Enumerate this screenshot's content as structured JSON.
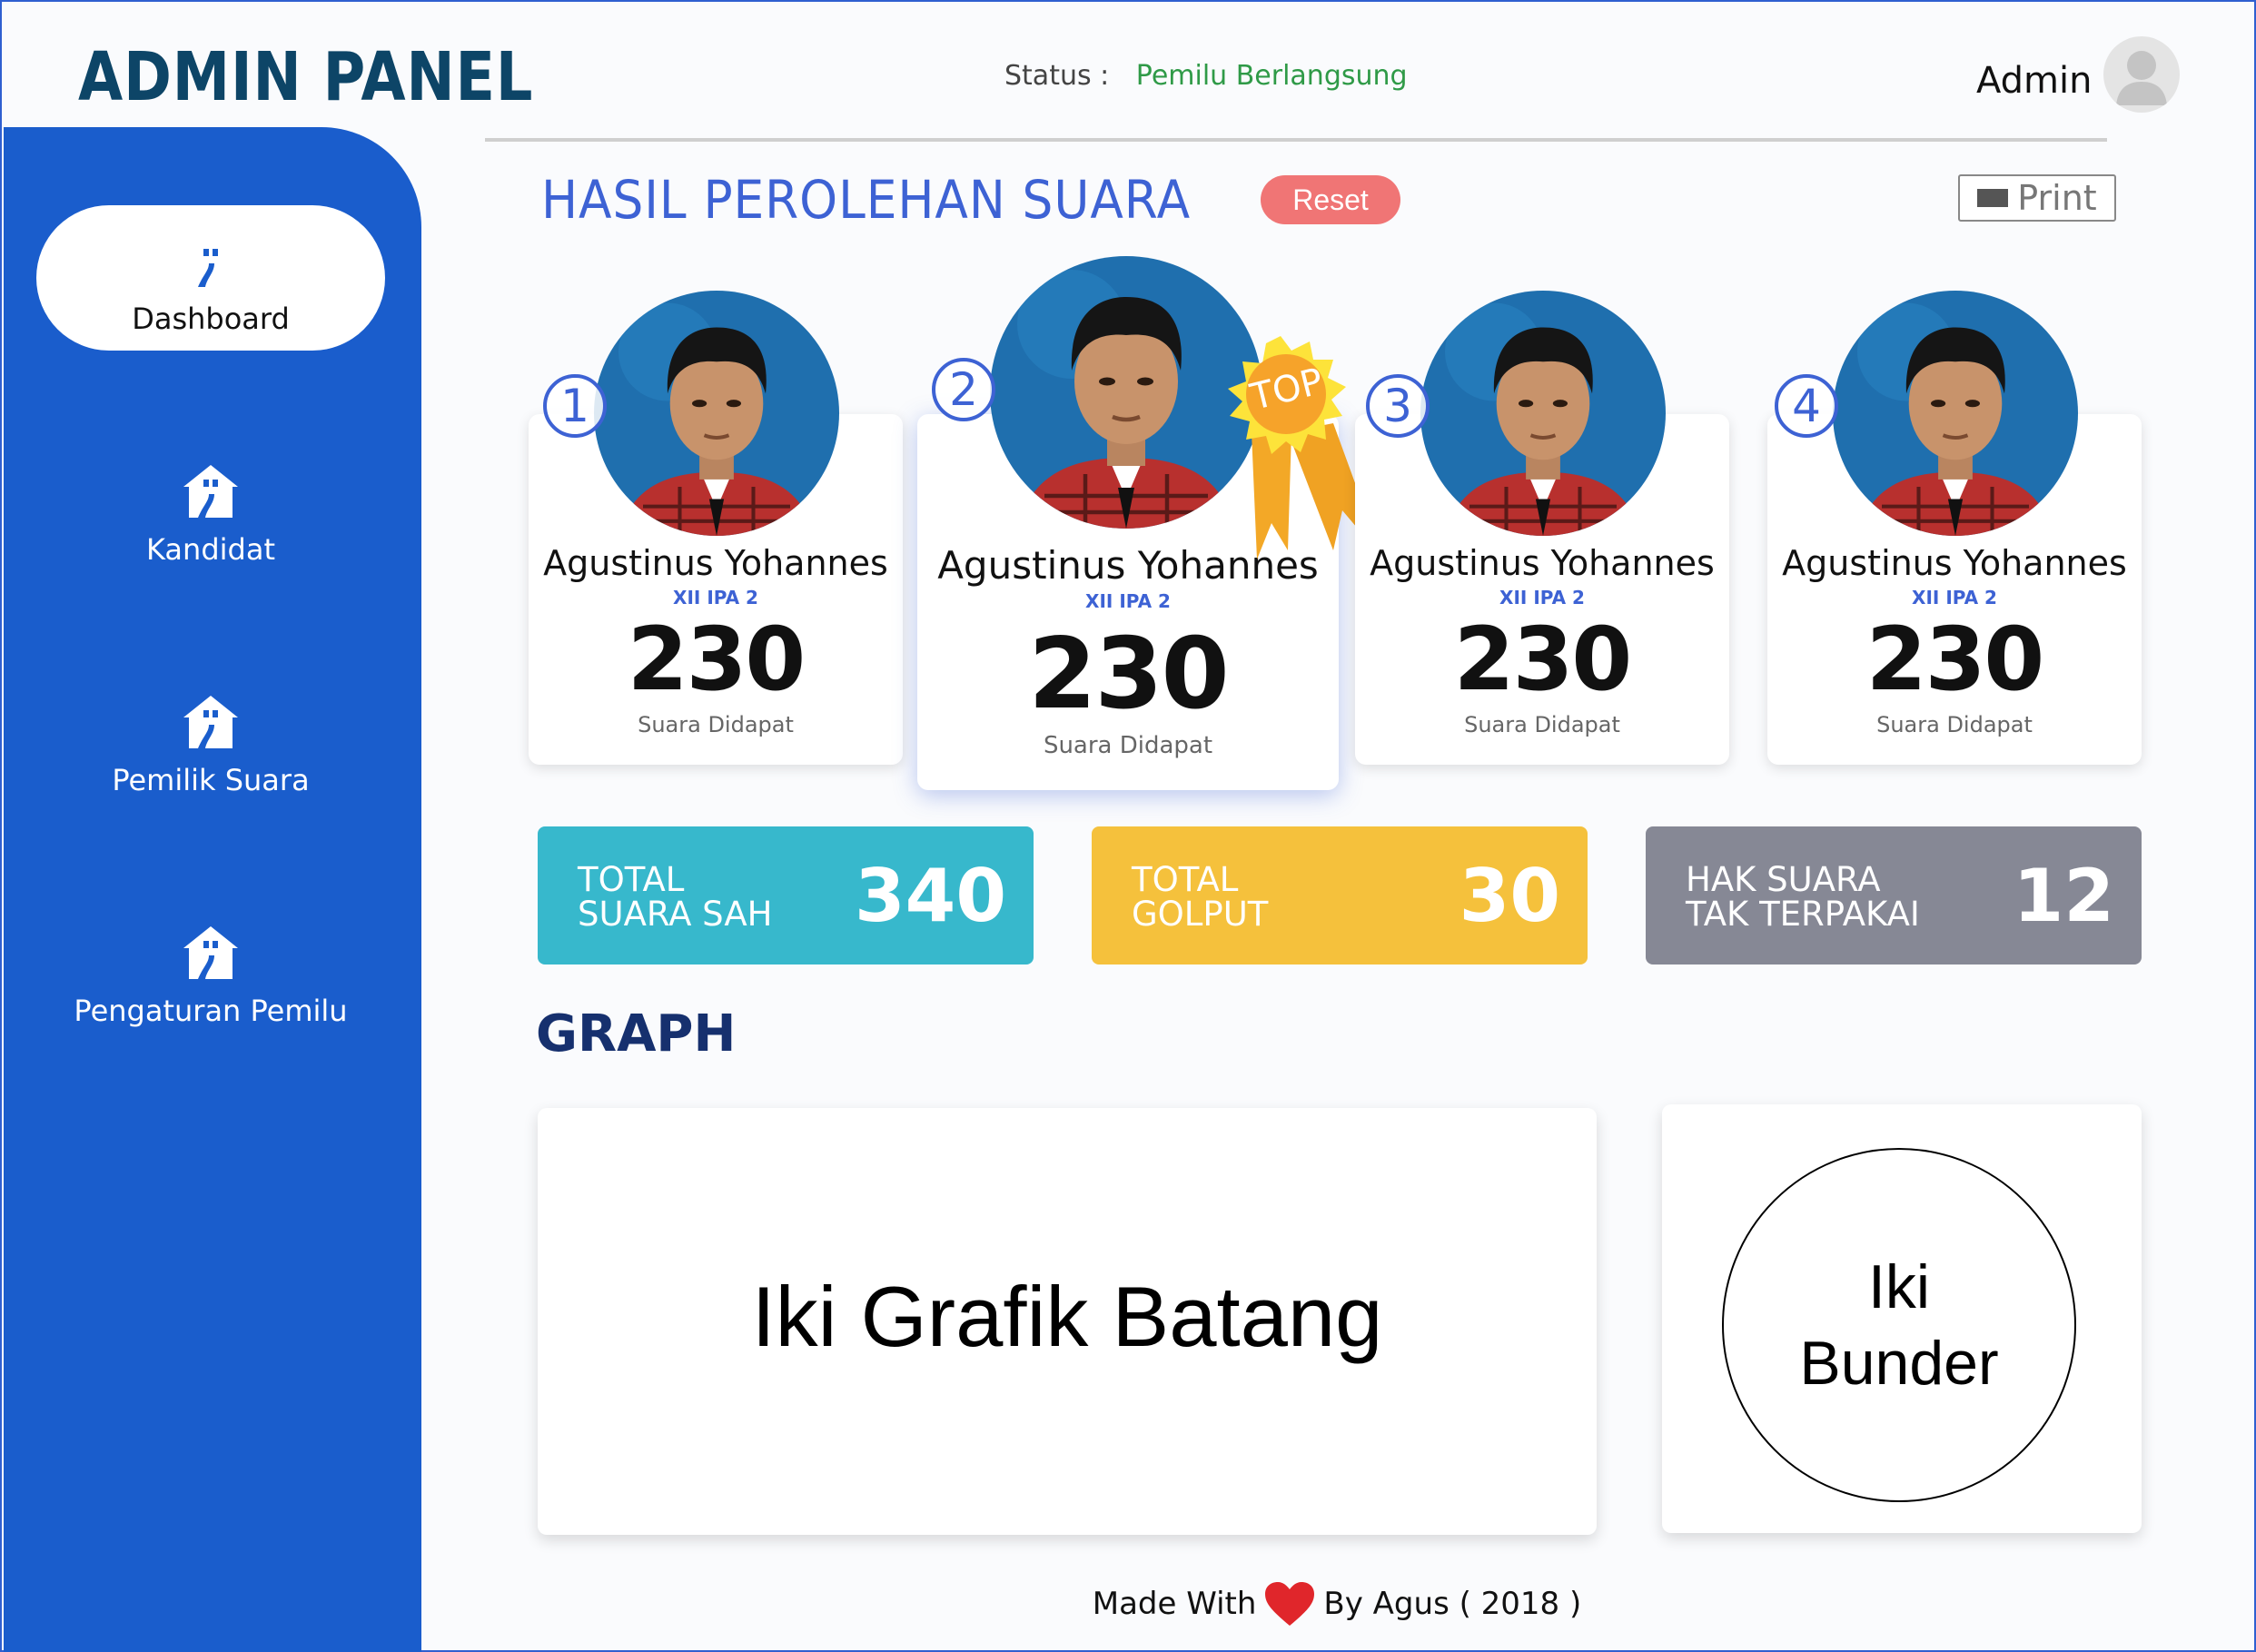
{
  "header": {
    "brand": "ADMIN PANEL",
    "status_label": "Status :",
    "status_value": "Pemilu Berlangsung",
    "user_name": "Admin"
  },
  "sidebar": {
    "items": [
      {
        "label": "Dashboard",
        "icon": "house-icon",
        "active": true
      },
      {
        "label": "Kandidat",
        "icon": "house-icon"
      },
      {
        "label": "Pemilik Suara",
        "icon": "house-icon"
      },
      {
        "label": "Pengaturan Pemilu",
        "icon": "house-icon"
      }
    ]
  },
  "results": {
    "title": "HASIL PEROLEHAN SUARA",
    "reset_label": "Reset",
    "print_label": "Print",
    "top_badge": "TOP",
    "candidates": [
      {
        "number": "1",
        "name": "Agustinus Yohannes",
        "class": "XII IPA 2",
        "votes": "230",
        "votes_label": "Suara Didapat"
      },
      {
        "number": "2",
        "name": "Agustinus Yohannes",
        "class": "XII IPA 2",
        "votes": "230",
        "votes_label": "Suara Didapat"
      },
      {
        "number": "3",
        "name": "Agustinus Yohannes",
        "class": "XII IPA 2",
        "votes": "230",
        "votes_label": "Suara Didapat"
      },
      {
        "number": "4",
        "name": "Agustinus Yohannes",
        "class": "XII IPA 2",
        "votes": "230",
        "votes_label": "Suara Didapat"
      }
    ]
  },
  "stats": [
    {
      "label": "TOTAL\nSUARA SAH",
      "value": "340",
      "color": "#37b8cc"
    },
    {
      "label": "TOTAL\nGOLPUT",
      "value": "30",
      "color": "#f5c13c"
    },
    {
      "label": "HAK SUARA\nTAK TERPAKAI",
      "value": "12",
      "color": "#868895"
    }
  ],
  "graph": {
    "title": "GRAPH",
    "bar_placeholder": "Iki Grafik Batang",
    "pie_placeholder": "Iki\nBunder"
  },
  "footer": {
    "made_with": "Made With",
    "by": "By Agus ( 2018 )"
  },
  "colors": {
    "sidebar": "#1a5dcc",
    "accent": "#3d62d4",
    "status_ok": "#2f9a47",
    "reset": "#f07575"
  }
}
